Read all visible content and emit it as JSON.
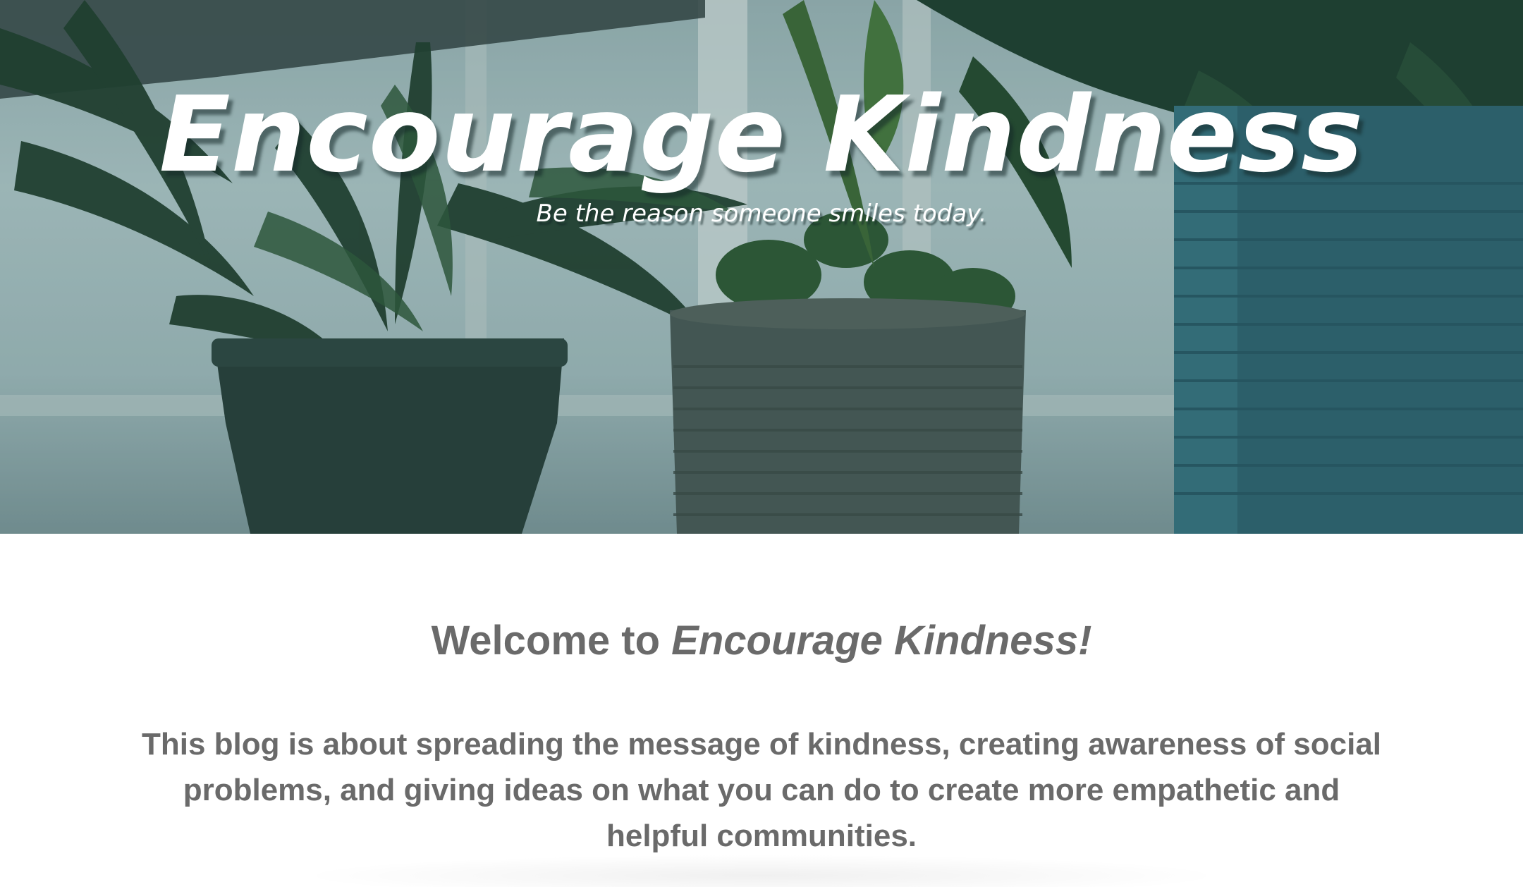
{
  "hero": {
    "title": "Encourage Kindness",
    "subtitle": "Be the reason someone smiles today."
  },
  "main": {
    "welcome_prefix": "Welcome to ",
    "welcome_emphasis": "Encourage Kindness!",
    "intro": "This blog is about spreading the message of kindness, creating awareness of social problems, and giving ideas on what you can do to create more empathetic and helpful communities."
  },
  "colors": {
    "hero_overlay": "#284648",
    "text_gray": "#6a6a6a",
    "title_white": "#ffffff"
  }
}
